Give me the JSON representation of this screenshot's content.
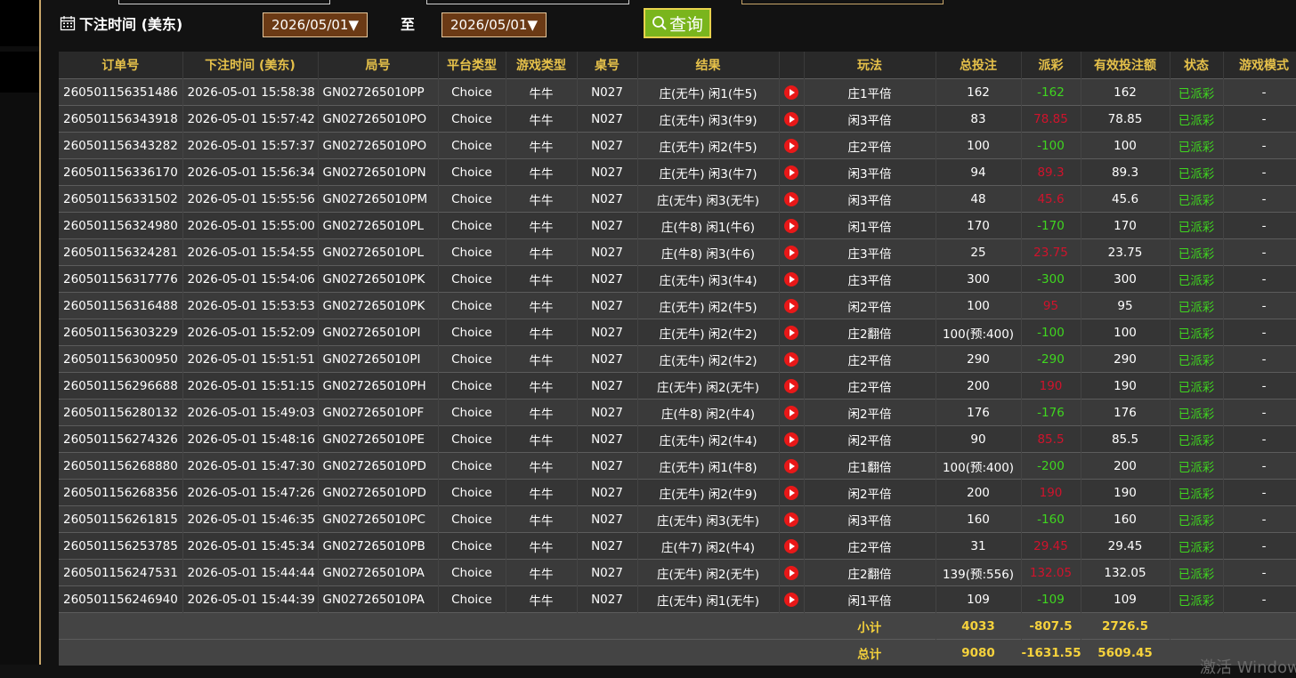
{
  "filter": {
    "time_label": "下注时间 (美东)",
    "start_date": "2026/05/01▼",
    "to_label": "至",
    "end_date": "2026/05/01▼",
    "query_label": "查询"
  },
  "table": {
    "headers": [
      "订单号",
      "下注时间 (美东)",
      "局号",
      "平台类型",
      "游戏类型",
      "桌号",
      "结果",
      "",
      "玩法",
      "总投注",
      "派彩",
      "有效投注额",
      "状态",
      "游戏模式"
    ],
    "rows": [
      {
        "order": "260501156351486",
        "time": "2026-05-01 15:58:38",
        "round": "GN027265010PP",
        "platform": "Choice",
        "game": "牛牛",
        "table": "N027",
        "result": "庄(无牛) 闲1(牛5)",
        "play": "庄1平倍",
        "bet": "162",
        "payout": "-162",
        "valid": "162",
        "status": "已派彩",
        "mode": "-"
      },
      {
        "order": "260501156343918",
        "time": "2026-05-01 15:57:42",
        "round": "GN027265010PO",
        "platform": "Choice",
        "game": "牛牛",
        "table": "N027",
        "result": "庄(无牛) 闲3(牛9)",
        "play": "闲3平倍",
        "bet": "83",
        "payout": "78.85",
        "valid": "78.85",
        "status": "已派彩",
        "mode": "-"
      },
      {
        "order": "260501156343282",
        "time": "2026-05-01 15:57:37",
        "round": "GN027265010PO",
        "platform": "Choice",
        "game": "牛牛",
        "table": "N027",
        "result": "庄(无牛) 闲2(牛5)",
        "play": "庄2平倍",
        "bet": "100",
        "payout": "-100",
        "valid": "100",
        "status": "已派彩",
        "mode": "-"
      },
      {
        "order": "260501156336170",
        "time": "2026-05-01 15:56:34",
        "round": "GN027265010PN",
        "platform": "Choice",
        "game": "牛牛",
        "table": "N027",
        "result": "庄(无牛) 闲3(牛7)",
        "play": "闲3平倍",
        "bet": "94",
        "payout": "89.3",
        "valid": "89.3",
        "status": "已派彩",
        "mode": "-"
      },
      {
        "order": "260501156331502",
        "time": "2026-05-01 15:55:56",
        "round": "GN027265010PM",
        "platform": "Choice",
        "game": "牛牛",
        "table": "N027",
        "result": "庄(无牛) 闲3(无牛)",
        "play": "闲3平倍",
        "bet": "48",
        "payout": "45.6",
        "valid": "45.6",
        "status": "已派彩",
        "mode": "-"
      },
      {
        "order": "260501156324980",
        "time": "2026-05-01 15:55:00",
        "round": "GN027265010PL",
        "platform": "Choice",
        "game": "牛牛",
        "table": "N027",
        "result": "庄(牛8) 闲1(牛6)",
        "play": "闲1平倍",
        "bet": "170",
        "payout": "-170",
        "valid": "170",
        "status": "已派彩",
        "mode": "-"
      },
      {
        "order": "260501156324281",
        "time": "2026-05-01 15:54:55",
        "round": "GN027265010PL",
        "platform": "Choice",
        "game": "牛牛",
        "table": "N027",
        "result": "庄(牛8) 闲3(牛6)",
        "play": "庄3平倍",
        "bet": "25",
        "payout": "23.75",
        "valid": "23.75",
        "status": "已派彩",
        "mode": "-"
      },
      {
        "order": "260501156317776",
        "time": "2026-05-01 15:54:06",
        "round": "GN027265010PK",
        "platform": "Choice",
        "game": "牛牛",
        "table": "N027",
        "result": "庄(无牛) 闲3(牛4)",
        "play": "庄3平倍",
        "bet": "300",
        "payout": "-300",
        "valid": "300",
        "status": "已派彩",
        "mode": "-"
      },
      {
        "order": "260501156316488",
        "time": "2026-05-01 15:53:53",
        "round": "GN027265010PK",
        "platform": "Choice",
        "game": "牛牛",
        "table": "N027",
        "result": "庄(无牛) 闲2(牛5)",
        "play": "闲2平倍",
        "bet": "100",
        "payout": "95",
        "valid": "95",
        "status": "已派彩",
        "mode": "-"
      },
      {
        "order": "260501156303229",
        "time": "2026-05-01 15:52:09",
        "round": "GN027265010PI",
        "platform": "Choice",
        "game": "牛牛",
        "table": "N027",
        "result": "庄(无牛) 闲2(牛2)",
        "play": "庄2翻倍",
        "bet": "100(预:400)",
        "payout": "-100",
        "valid": "100",
        "status": "已派彩",
        "mode": "-"
      },
      {
        "order": "260501156300950",
        "time": "2026-05-01 15:51:51",
        "round": "GN027265010PI",
        "platform": "Choice",
        "game": "牛牛",
        "table": "N027",
        "result": "庄(无牛) 闲2(牛2)",
        "play": "庄2平倍",
        "bet": "290",
        "payout": "-290",
        "valid": "290",
        "status": "已派彩",
        "mode": "-"
      },
      {
        "order": "260501156296688",
        "time": "2026-05-01 15:51:15",
        "round": "GN027265010PH",
        "platform": "Choice",
        "game": "牛牛",
        "table": "N027",
        "result": "庄(无牛) 闲2(无牛)",
        "play": "庄2平倍",
        "bet": "200",
        "payout": "190",
        "valid": "190",
        "status": "已派彩",
        "mode": "-"
      },
      {
        "order": "260501156280132",
        "time": "2026-05-01 15:49:03",
        "round": "GN027265010PF",
        "platform": "Choice",
        "game": "牛牛",
        "table": "N027",
        "result": "庄(牛8) 闲2(牛4)",
        "play": "闲2平倍",
        "bet": "176",
        "payout": "-176",
        "valid": "176",
        "status": "已派彩",
        "mode": "-"
      },
      {
        "order": "260501156274326",
        "time": "2026-05-01 15:48:16",
        "round": "GN027265010PE",
        "platform": "Choice",
        "game": "牛牛",
        "table": "N027",
        "result": "庄(无牛) 闲2(牛4)",
        "play": "闲2平倍",
        "bet": "90",
        "payout": "85.5",
        "valid": "85.5",
        "status": "已派彩",
        "mode": "-"
      },
      {
        "order": "260501156268880",
        "time": "2026-05-01 15:47:30",
        "round": "GN027265010PD",
        "platform": "Choice",
        "game": "牛牛",
        "table": "N027",
        "result": "庄(无牛) 闲1(牛8)",
        "play": "庄1翻倍",
        "bet": "100(预:400)",
        "payout": "-200",
        "valid": "200",
        "status": "已派彩",
        "mode": "-"
      },
      {
        "order": "260501156268356",
        "time": "2026-05-01 15:47:26",
        "round": "GN027265010PD",
        "platform": "Choice",
        "game": "牛牛",
        "table": "N027",
        "result": "庄(无牛) 闲2(牛9)",
        "play": "闲2平倍",
        "bet": "200",
        "payout": "190",
        "valid": "190",
        "status": "已派彩",
        "mode": "-"
      },
      {
        "order": "260501156261815",
        "time": "2026-05-01 15:46:35",
        "round": "GN027265010PC",
        "platform": "Choice",
        "game": "牛牛",
        "table": "N027",
        "result": "庄(无牛) 闲3(无牛)",
        "play": "闲3平倍",
        "bet": "160",
        "payout": "-160",
        "valid": "160",
        "status": "已派彩",
        "mode": "-"
      },
      {
        "order": "260501156253785",
        "time": "2026-05-01 15:45:34",
        "round": "GN027265010PB",
        "platform": "Choice",
        "game": "牛牛",
        "table": "N027",
        "result": "庄(牛7) 闲2(牛4)",
        "play": "庄2平倍",
        "bet": "31",
        "payout": "29.45",
        "valid": "29.45",
        "status": "已派彩",
        "mode": "-"
      },
      {
        "order": "260501156247531",
        "time": "2026-05-01 15:44:44",
        "round": "GN027265010PA",
        "platform": "Choice",
        "game": "牛牛",
        "table": "N027",
        "result": "庄(无牛) 闲2(无牛)",
        "play": "庄2翻倍",
        "bet": "139(预:556)",
        "payout": "132.05",
        "valid": "132.05",
        "status": "已派彩",
        "mode": "-"
      },
      {
        "order": "260501156246940",
        "time": "2026-05-01 15:44:39",
        "round": "GN027265010PA",
        "platform": "Choice",
        "game": "牛牛",
        "table": "N027",
        "result": "庄(无牛) 闲1(无牛)",
        "play": "闲1平倍",
        "bet": "109",
        "payout": "-109",
        "valid": "109",
        "status": "已派彩",
        "mode": "-"
      }
    ],
    "subtotal": {
      "label": "小计",
      "bet": "4033",
      "payout": "-807.5",
      "valid": "2726.5"
    },
    "total": {
      "label": "总计",
      "bet": "9080",
      "payout": "-1631.55",
      "valid": "5609.45"
    }
  },
  "watermark": "激活 Windows",
  "icons": {
    "calendar": "calendar-icon",
    "search": "search-icon",
    "play": "play-video-icon"
  },
  "colors": {
    "header_text": "#e6c14a",
    "negative": "#3fd61f",
    "positive": "#d0132c",
    "status": "#3fd61f",
    "accent": "#c8a66a",
    "query_button": "#7ab51d"
  }
}
